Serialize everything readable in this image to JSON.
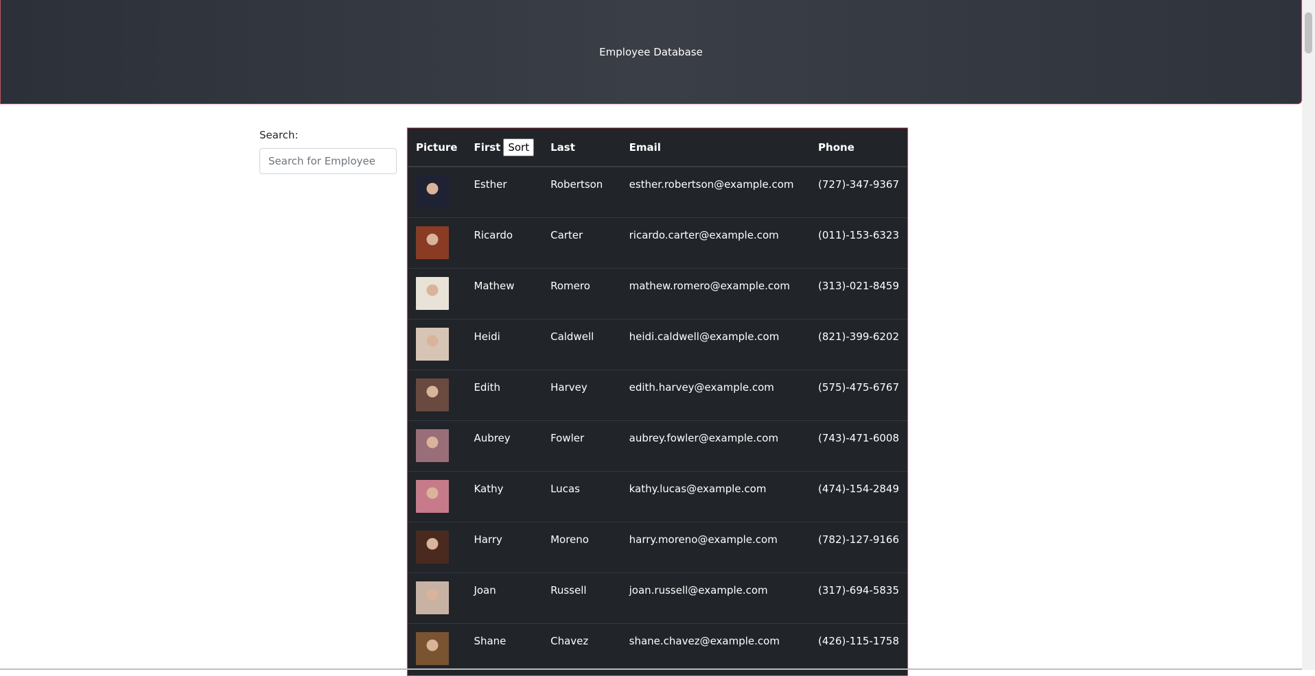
{
  "header": {
    "title": "Employee Database"
  },
  "search": {
    "label": "Search:",
    "placeholder": "Search for Employee",
    "value": ""
  },
  "table": {
    "columns": {
      "picture": "Picture",
      "first": "First",
      "sort_button": "Sort",
      "last": "Last",
      "email": "Email",
      "phone": "Phone"
    },
    "rows": [
      {
        "first": "Esther",
        "last": "Robertson",
        "email": "esther.robertson@example.com",
        "phone": "(727)-347-9367",
        "avatar_color": "#1f2233"
      },
      {
        "first": "Ricardo",
        "last": "Carter",
        "email": "ricardo.carter@example.com",
        "phone": "(011)-153-6323",
        "avatar_color": "#8a3b23"
      },
      {
        "first": "Mathew",
        "last": "Romero",
        "email": "mathew.romero@example.com",
        "phone": "(313)-021-8459",
        "avatar_color": "#e9e2d6"
      },
      {
        "first": "Heidi",
        "last": "Caldwell",
        "email": "heidi.caldwell@example.com",
        "phone": "(821)-399-6202",
        "avatar_color": "#d8c4b4"
      },
      {
        "first": "Edith",
        "last": "Harvey",
        "email": "edith.harvey@example.com",
        "phone": "(575)-475-6767",
        "avatar_color": "#6a4a3e"
      },
      {
        "first": "Aubrey",
        "last": "Fowler",
        "email": "aubrey.fowler@example.com",
        "phone": "(743)-471-6008",
        "avatar_color": "#9a6e78"
      },
      {
        "first": "Kathy",
        "last": "Lucas",
        "email": "kathy.lucas@example.com",
        "phone": "(474)-154-2849",
        "avatar_color": "#c77a8a"
      },
      {
        "first": "Harry",
        "last": "Moreno",
        "email": "harry.moreno@example.com",
        "phone": "(782)-127-9166",
        "avatar_color": "#4a2a1e"
      },
      {
        "first": "Joan",
        "last": "Russell",
        "email": "joan.russell@example.com",
        "phone": "(317)-694-5835",
        "avatar_color": "#c8b2a3"
      },
      {
        "first": "Shane",
        "last": "Chavez",
        "email": "shane.chavez@example.com",
        "phone": "(426)-115-1758",
        "avatar_color": "#7a5430"
      }
    ]
  },
  "colors": {
    "header_bg": "#343a40",
    "table_bg": "#212529",
    "border_accent": "#e0485a"
  }
}
